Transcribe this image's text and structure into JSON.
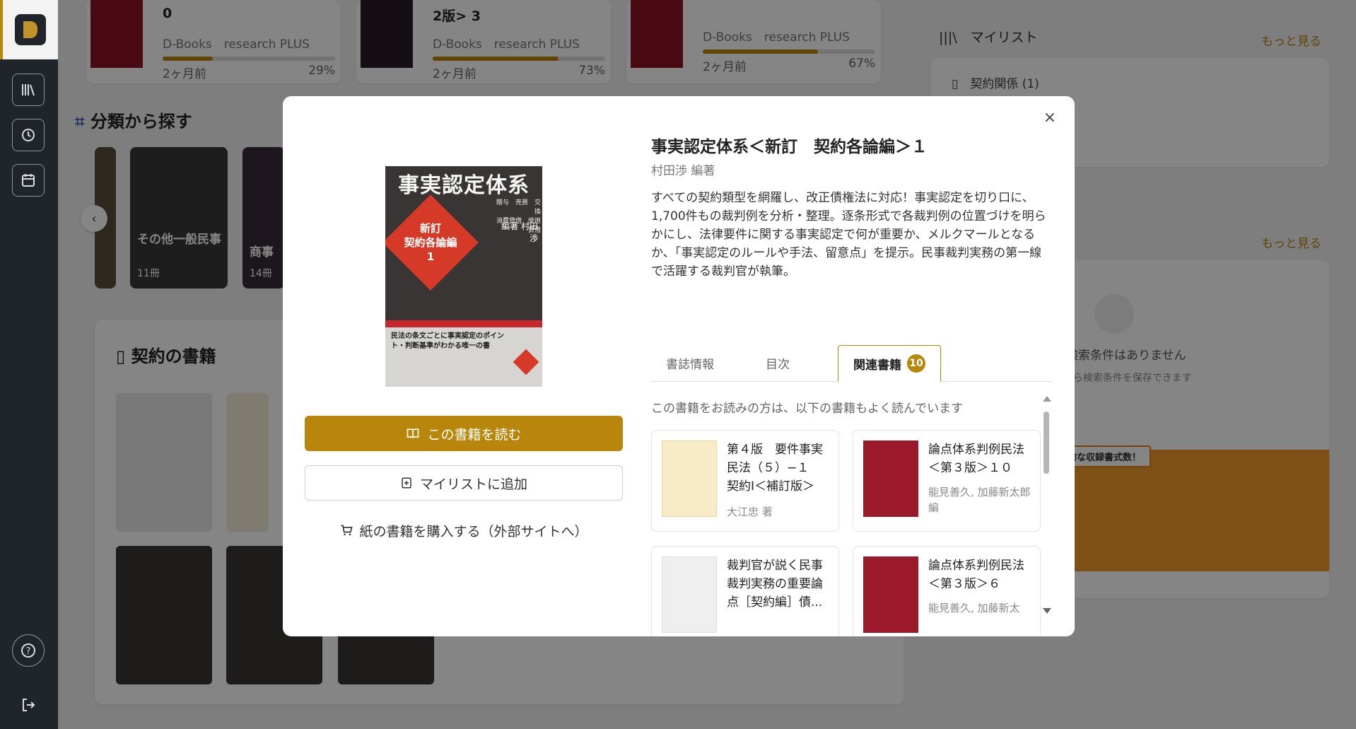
{
  "sidebar": {
    "icons": [
      "library-icon",
      "history-icon",
      "calendar-search-icon"
    ],
    "help_icon": "help-icon",
    "logout_icon": "logout-icon"
  },
  "recent": [
    {
      "title": "0",
      "source_a": "D-Books",
      "source_b": "research PLUS",
      "time": "2ヶ月前",
      "percent": "29%",
      "progress": 0.29
    },
    {
      "title": "2版> 3",
      "source_a": "D-Books",
      "source_b": "research PLUS",
      "time": "2ヶ月前",
      "percent": "73%",
      "progress": 0.73
    },
    {
      "title": "",
      "source_a": "D-Books",
      "source_b": "research PLUS",
      "time": "2ヶ月前",
      "percent": "67%",
      "progress": 0.67
    }
  ],
  "category_section": {
    "title": "分類から探す",
    "cards": [
      {
        "label": "その他一般民事",
        "count": "11冊"
      },
      {
        "label": "商事",
        "count": "14冊"
      }
    ]
  },
  "contract_section": {
    "title": "契約の書籍"
  },
  "right": {
    "mylist_title": "マイリスト",
    "more_link": "もっと見る",
    "mylist_item": "契約関係 (1)",
    "more_link_2": "もっと見る",
    "saved_search_empty": "れた検索条件はありません",
    "saved_search_hint": "ージから検索条件を保存できます",
    "banner_badge": "圧倒的な収録書式数！"
  },
  "modal": {
    "close": "×",
    "cover": {
      "title": "事実認定体系",
      "diamond_text": "新訂\n契約各論編\n1",
      "subjects": "贈与　売買　交換\n消費貸借　使用貸借",
      "author": "編著 村田 渉",
      "tagline": "民法の条文ごとに事実認定のポイント・判断基準がわかる唯一の書"
    },
    "title": "事実認定体系＜新訂　契約各論編＞１",
    "author": "村田渉 編著",
    "description": "すべての契約類型を網羅し、改正債権法に対応！事実認定を切り口に、1,700件もの裁判例を分析・整理。逐条形式で各裁判例の位置づけを明らかにし、法律要件に関する事実認定で何が重要か、メルクマールとなるか、「事実認定のルールや手法、留意点」を提示。民事裁判実務の第一線で活躍する裁判官が執筆。",
    "read_button": "この書籍を読む",
    "mylist_button": "マイリストに追加",
    "buy_link": "紙の書籍を購入する（外部サイトへ）",
    "tabs": [
      {
        "label": "書誌情報"
      },
      {
        "label": "目次"
      },
      {
        "label": "関連書籍",
        "badge": "10"
      }
    ],
    "related_note": "この書籍をお読みの方は、以下の書籍もよく読んでいます",
    "related": [
      {
        "title": "第４版　要件事実民法（５）−１　契約Ⅰ＜補訂版＞",
        "author": "大江忠 著"
      },
      {
        "title": "論点体系判例民法＜第３版＞１０",
        "author": "能見善久, 加藤新太郎 編"
      },
      {
        "title": "裁判官が説く民事裁判実務の重要論点［契約編］債...",
        "author": ""
      },
      {
        "title": "論点体系判例民法＜第３版＞６",
        "author": "能見善久, 加藤新太"
      }
    ]
  }
}
